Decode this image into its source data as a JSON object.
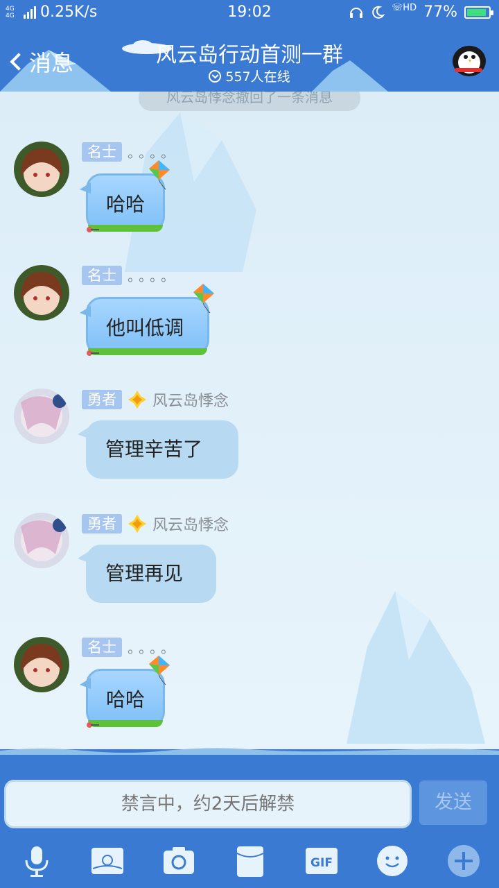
{
  "status_bar": {
    "network": "4G 4G",
    "speed": "0.25K/s",
    "time": "19:02",
    "hd_label": "HD",
    "battery": "77%"
  },
  "header": {
    "back_label": "消息",
    "title": "风云岛行动首测一群",
    "online": "557人在线"
  },
  "chat": {
    "system_notice": "风云岛悸念撤回了一条消息",
    "messages": [
      {
        "badge": "名士",
        "nickname": "。。。。",
        "text": "哈哈",
        "style": "fancy"
      },
      {
        "badge": "名士",
        "nickname": "。。。。",
        "text": "他叫低调",
        "style": "fancy"
      },
      {
        "badge": "勇者",
        "nickname": "风云岛悸念",
        "text": "管理辛苦了",
        "style": "plain"
      },
      {
        "badge": "勇者",
        "nickname": "风云岛悸念",
        "text": "管理再见",
        "style": "plain"
      },
      {
        "badge": "名士",
        "nickname": "。。。。",
        "text": "哈哈",
        "style": "fancy"
      }
    ]
  },
  "input": {
    "placeholder": "禁言中，约2天后解禁",
    "send_label": "发送"
  },
  "toolbar": {
    "icons": [
      "microphone-icon",
      "photo-album-icon",
      "camera-icon",
      "red-packet-icon",
      "gif-icon",
      "emoji-icon",
      "plus-icon"
    ],
    "gif_label": "GIF"
  },
  "colors": {
    "header_bg": "#3a7ad3",
    "chat_bg": "#e6f3fb",
    "bubble_plain": "#b7d9f2",
    "badge": "#a6c6f0"
  }
}
